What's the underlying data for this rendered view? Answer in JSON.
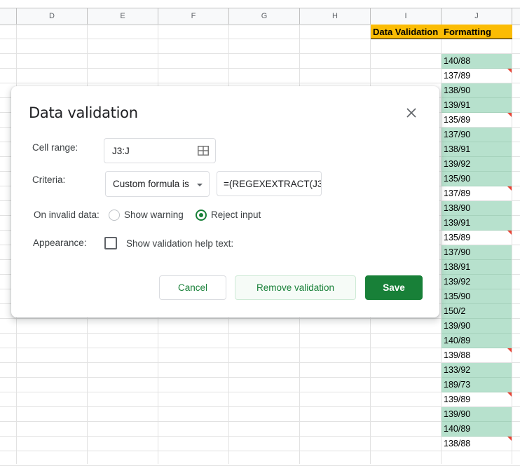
{
  "spreadsheet": {
    "columns": [
      "D",
      "E",
      "F",
      "G",
      "H",
      "I",
      "J"
    ],
    "header_row": {
      "I": "Data Validation",
      "J": "Formatting"
    },
    "column_j_values": [
      {
        "value": "",
        "style": "empty",
        "invalid": false
      },
      {
        "value": "140/88",
        "style": "green",
        "invalid": false
      },
      {
        "value": "137/89",
        "style": "white",
        "invalid": true
      },
      {
        "value": "138/90",
        "style": "green",
        "invalid": false
      },
      {
        "value": "139/91",
        "style": "green",
        "invalid": false
      },
      {
        "value": "135/89",
        "style": "white",
        "invalid": true
      },
      {
        "value": "137/90",
        "style": "green",
        "invalid": false
      },
      {
        "value": "138/91",
        "style": "green",
        "invalid": false
      },
      {
        "value": "139/92",
        "style": "green",
        "invalid": false
      },
      {
        "value": "135/90",
        "style": "green",
        "invalid": false
      },
      {
        "value": "137/89",
        "style": "white",
        "invalid": true
      },
      {
        "value": "138/90",
        "style": "green",
        "invalid": false
      },
      {
        "value": "139/91",
        "style": "green",
        "invalid": false
      },
      {
        "value": "135/89",
        "style": "white",
        "invalid": true
      },
      {
        "value": "137/90",
        "style": "green",
        "invalid": false
      },
      {
        "value": "138/91",
        "style": "green",
        "invalid": false
      },
      {
        "value": "139/92",
        "style": "green",
        "invalid": false
      },
      {
        "value": "135/90",
        "style": "green",
        "invalid": false
      },
      {
        "value": "150/2",
        "style": "green",
        "invalid": false
      },
      {
        "value": "139/90",
        "style": "green",
        "invalid": false
      },
      {
        "value": "140/89",
        "style": "green",
        "invalid": false
      },
      {
        "value": "139/88",
        "style": "white",
        "invalid": true
      },
      {
        "value": "133/92",
        "style": "green",
        "invalid": false
      },
      {
        "value": "189/73",
        "style": "green",
        "invalid": false
      },
      {
        "value": "139/89",
        "style": "white",
        "invalid": true
      },
      {
        "value": "139/90",
        "style": "green",
        "invalid": false
      },
      {
        "value": "140/89",
        "style": "green",
        "invalid": false
      },
      {
        "value": "138/88",
        "style": "white",
        "invalid": true
      },
      {
        "value": "",
        "style": "empty",
        "invalid": false
      }
    ],
    "colors": {
      "header_fill": "#fbbc04",
      "valid_fill": "#b7e1cd",
      "invalid_marker": "#ea4335"
    }
  },
  "dialog": {
    "title": "Data validation",
    "close_icon": "close-icon",
    "cell_range": {
      "label": "Cell range:",
      "value": "J3:J",
      "icon": "select-range-grid-icon"
    },
    "criteria": {
      "label": "Criteria:",
      "selected": "Custom formula is",
      "formula": "=(REGEXEXTRACT(J3"
    },
    "on_invalid": {
      "label": "On invalid data:",
      "options": [
        {
          "label": "Show warning",
          "checked": false
        },
        {
          "label": "Reject input",
          "checked": true
        }
      ]
    },
    "appearance": {
      "label": "Appearance:",
      "checkbox_label": "Show validation help text:",
      "checked": false
    },
    "buttons": {
      "cancel": "Cancel",
      "remove": "Remove validation",
      "save": "Save"
    },
    "accent_color": "#188038"
  }
}
